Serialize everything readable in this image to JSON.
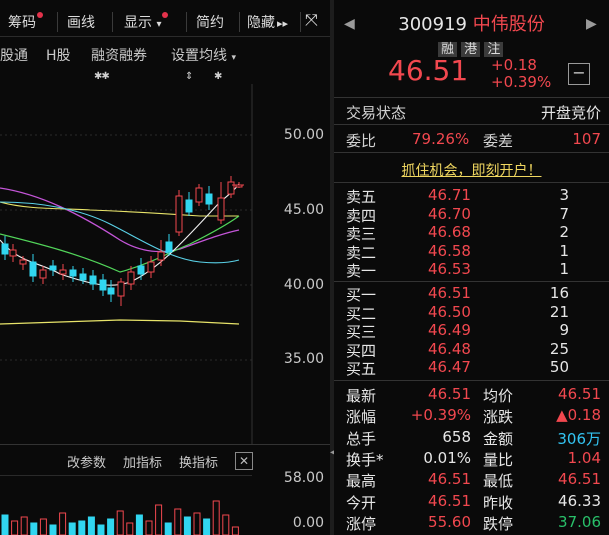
{
  "toolbar": {
    "items": [
      "筹码",
      "画线",
      "显示",
      "简约",
      "隐藏"
    ],
    "more_glyph": "▸▸",
    "expand_glyph": "⤧"
  },
  "chart_tabs": [
    "股通",
    "H股",
    "融资融券",
    "设置均线"
  ],
  "chart_marks": [
    "✱✱",
    "⇕",
    "✱"
  ],
  "price_axis": [
    "50.00",
    "45.00",
    "40.00",
    "35.00"
  ],
  "sub_toolbar": [
    "改参数",
    "加指标",
    "换指标"
  ],
  "sub_axis": [
    "58.00",
    "0.00"
  ],
  "colors": {
    "up": "#f2484f",
    "down": "#29c06a",
    "ma_yellow": "#e8e46a",
    "ma_green": "#52d55a",
    "ma_purple": "#c455d8",
    "ma_cyan": "#5ad2e8",
    "vol_cyan": "#31d6f0"
  },
  "quote": {
    "code": "300919",
    "name": "中伟股份",
    "tags": [
      "融",
      "港",
      "注"
    ],
    "price": "46.51",
    "change": "+0.18",
    "change_pct": "+0.39%",
    "status_label": "交易状态",
    "status_value": "开盘竞价",
    "wb_label": "委比",
    "wb_value": "79.26%",
    "wc_label": "委差",
    "wc_value": "107",
    "promo": "抓住机会，即刻开户！",
    "asks": [
      {
        "label": "卖五",
        "price": "46.71",
        "vol": "3"
      },
      {
        "label": "卖四",
        "price": "46.70",
        "vol": "7"
      },
      {
        "label": "卖三",
        "price": "46.68",
        "vol": "2"
      },
      {
        "label": "卖二",
        "price": "46.58",
        "vol": "1"
      },
      {
        "label": "卖一",
        "price": "46.53",
        "vol": "1"
      }
    ],
    "bids": [
      {
        "label": "买一",
        "price": "46.51",
        "vol": "16"
      },
      {
        "label": "买二",
        "price": "46.50",
        "vol": "21"
      },
      {
        "label": "买三",
        "price": "46.49",
        "vol": "9"
      },
      {
        "label": "买四",
        "price": "46.48",
        "vol": "25"
      },
      {
        "label": "买五",
        "price": "46.47",
        "vol": "50"
      }
    ],
    "stats": [
      {
        "l1": "最新",
        "v1": "46.51",
        "c1": "red",
        "l2": "均价",
        "v2": "46.51",
        "c2": "red"
      },
      {
        "l1": "涨幅",
        "v1": "+0.39%",
        "c1": "red",
        "l2": "涨跌",
        "v2": "▲0.18",
        "c2": "red"
      },
      {
        "l1": "总手",
        "v1": "658",
        "c1": "white",
        "l2": "金额",
        "v2": "306万",
        "c2": "cyan"
      },
      {
        "l1": "换手*",
        "v1": "0.01%",
        "c1": "white",
        "l2": "量比",
        "v2": "1.04",
        "c2": "red"
      },
      {
        "l1": "最高",
        "v1": "46.51",
        "c1": "red",
        "l2": "最低",
        "v2": "46.51",
        "c2": "red"
      },
      {
        "l1": "今开",
        "v1": "46.51",
        "c1": "red",
        "l2": "昨收",
        "v2": "46.33",
        "c2": "white"
      },
      {
        "l1": "涨停",
        "v1": "55.60",
        "c1": "red",
        "l2": "跌停",
        "v2": "37.06",
        "c2": "green"
      }
    ]
  }
}
